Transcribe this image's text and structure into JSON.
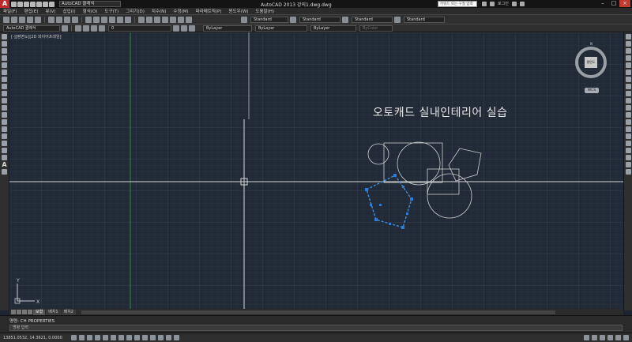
{
  "titlebar": {
    "workspace": "AutoCAD 클래식",
    "window_title": "AutoCAD 2013    강의1.dwg.dwg",
    "search_placeholder": "키워드 또는 구절 입력",
    "user": "로그인"
  },
  "menus": [
    "파일(F)",
    "편집(E)",
    "뷰(V)",
    "삽입(I)",
    "형식(O)",
    "도구(T)",
    "그리기(D)",
    "치수(N)",
    "수정(M)",
    "파라메트릭(P)",
    "윈도우(W)",
    "도움말(H)"
  ],
  "toolbar1": {
    "text_style": "Standard",
    "dim_style": "Standard",
    "table_style": "Standard",
    "mleader_style": "Standard"
  },
  "toolbar2": {
    "workspace": "AutoCAD 클래식",
    "layer": "0",
    "color": "ByLayer",
    "linetype": "ByLayer",
    "lineweight": "ByLayer",
    "plotstyle": "ByColor"
  },
  "canvas": {
    "viewport_label": "[-][평면도][2D 와이어프레임]",
    "drawing_text": "오토캐드 실내인테리어 실습",
    "viewcube_label": "평면도",
    "wcs_label": "WCS"
  },
  "tabs": [
    "모형",
    "배치1",
    "배치2"
  ],
  "command": {
    "history": "명령: CH PROPERTIES",
    "prompt": "명령 입력"
  },
  "status": {
    "coords": "13851.0532, 14.3621, 0.0000"
  },
  "colors": {
    "canvas_bg": "#212a36",
    "selection": "#2e7bd6"
  }
}
